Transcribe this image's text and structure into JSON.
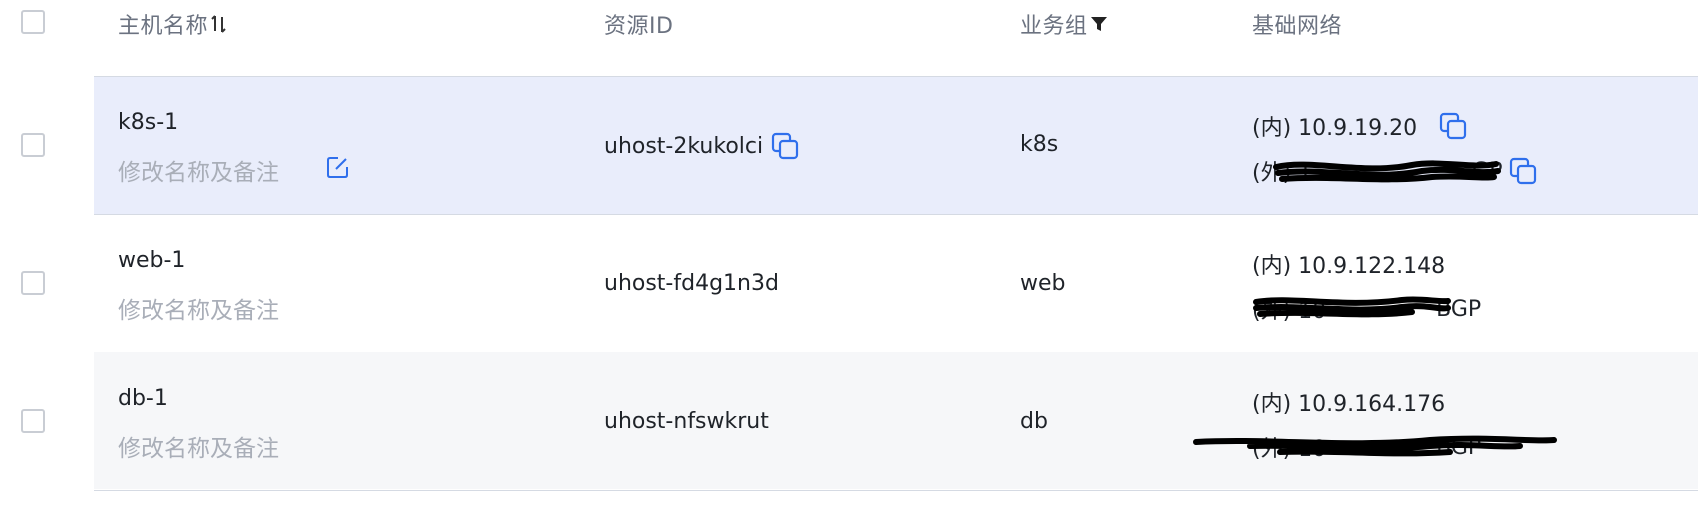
{
  "header": {
    "host_name": "主机名称",
    "resource_id": "资源ID",
    "business_group": "业务组",
    "base_network": "基础网络"
  },
  "rows": [
    {
      "host_name": "k8s-1",
      "remark_link": "修改名称及备注",
      "resource_id": "uhost-2kukolci",
      "business_group": "k8s",
      "inner_ip": "(内) 10.9.19.20",
      "outer_ip": "(外) 1",
      "outer_suffix": "GP"
    },
    {
      "host_name": "web-1",
      "remark_link": "修改名称及备注",
      "resource_id": "uhost-fd4g1n3d",
      "business_group": "web",
      "inner_ip": "(内) 10.9.122.148",
      "outer_ip": "(外) 10",
      "outer_suffix": "BGP"
    },
    {
      "host_name": "db-1",
      "remark_link": "修改名称及备注",
      "resource_id": "uhost-nfswkrut",
      "business_group": "db",
      "inner_ip": "(内) 10.9.164.176",
      "outer_ip": "(外) 10",
      "outer_suffix": "BGP"
    }
  ],
  "colors": {
    "accent": "#2f6fec",
    "selected_row": "#e9edfb",
    "muted_text": "#a9aeb8",
    "header_text": "#6b7280"
  }
}
